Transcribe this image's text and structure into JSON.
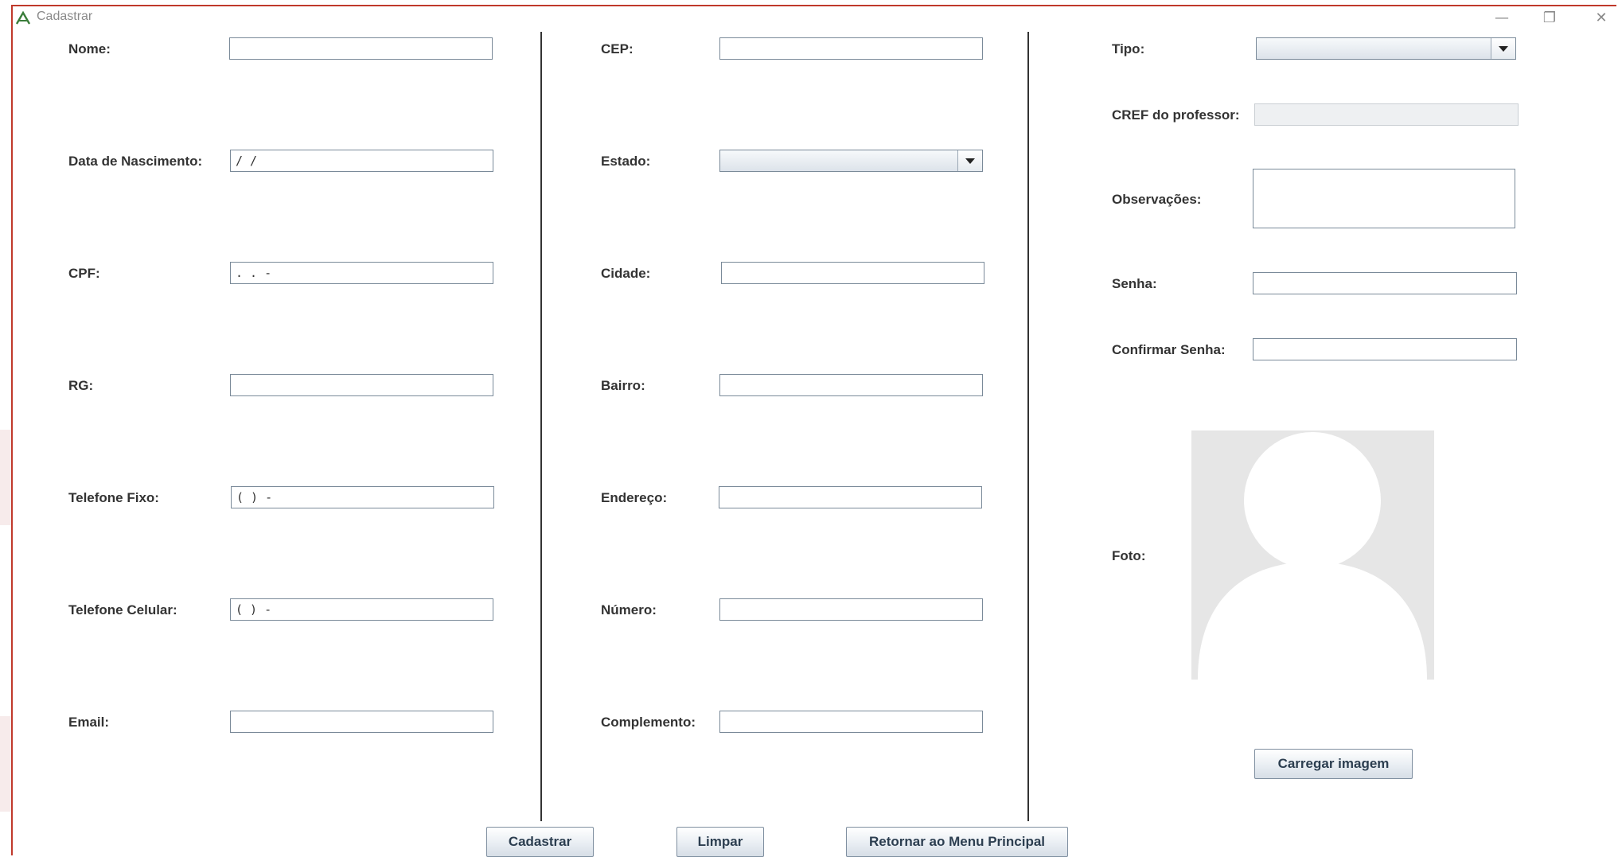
{
  "window": {
    "title": "Cadastrar",
    "controls": [
      "—",
      "❐",
      "✕"
    ]
  },
  "left_column": {
    "nome_label": "Nome:",
    "nome_value": "",
    "nascimento_label": "Data de Nascimento:",
    "nascimento_value": " / /",
    "cpf_label": "CPF:",
    "cpf_value": "  .  .  -",
    "rg_label": "RG:",
    "rg_value": "",
    "telefone_fixo_label": "Telefone Fixo:",
    "telefone_fixo_value": "( )  -",
    "telefone_celular_label": "Telefone Celular:",
    "telefone_celular_value": "( )  -",
    "email_label": "Email:",
    "email_value": ""
  },
  "middle_column": {
    "cep_label": "CEP:",
    "cep_value": "",
    "estado_label": "Estado:",
    "estado_value": "",
    "cidade_label": "Cidade:",
    "cidade_value": "",
    "bairro_label": "Bairro:",
    "bairro_value": "",
    "endereco_label": "Endereço:",
    "endereco_value": "",
    "numero_label": "Número:",
    "numero_value": "",
    "complemento_label": "Complemento:",
    "complemento_value": ""
  },
  "right_column": {
    "tipo_label": "Tipo:",
    "tipo_value": "",
    "cref_label": "CREF do professor:",
    "cref_value": "",
    "observacoes_label": "Observações:",
    "senha_label": "Senha:",
    "confirmar_senha_label": "Confirmar Senha:",
    "foto_label": "Foto:",
    "carregar_imagem_label": "Carregar imagem"
  },
  "footer": {
    "cadastrar_label": "Cadastrar",
    "limpar_label": "Limpar",
    "retornar_label": "Retornar ao Menu Principal"
  },
  "colors": {
    "border_accent": "#c0392b",
    "label": "#333333",
    "photo_bg": "#e6e6e6"
  }
}
